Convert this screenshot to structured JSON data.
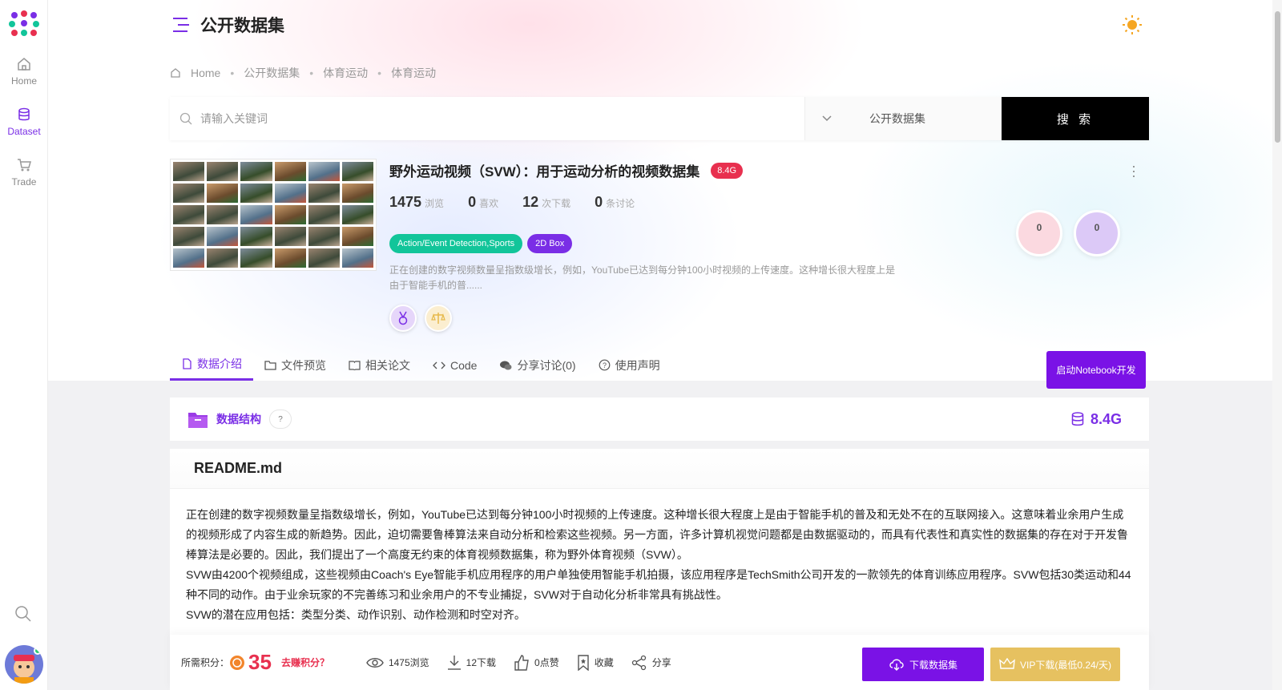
{
  "rail": {
    "items": [
      {
        "label": "Home",
        "icon": "home-icon"
      },
      {
        "label": "Dataset",
        "icon": "database-icon"
      },
      {
        "label": "Trade",
        "icon": "cart-icon"
      }
    ],
    "search_icon": "search-icon"
  },
  "header": {
    "title": "公开数据集",
    "theme_icon": "sun-icon"
  },
  "breadcrumb": [
    "Home",
    "公开数据集",
    "体育运动",
    "体育运动"
  ],
  "search": {
    "placeholder": "请输入关键词",
    "category": "公开数据集",
    "button": "搜 索"
  },
  "dataset": {
    "title": "野外运动视频（SVW）：用于运动分析的视频数据集",
    "size": "8.4G",
    "stats": [
      {
        "value": "1475",
        "unit": "浏览"
      },
      {
        "value": "0",
        "unit": "喜欢"
      },
      {
        "value": "12",
        "unit": "次下载"
      },
      {
        "value": "0",
        "unit": "条讨论"
      }
    ],
    "tags": [
      "Action/Event Detection,Sports",
      "2D Box"
    ],
    "description": "正在创建的数字视频数量呈指数级增长，例如，YouTube已达到每分钟100小时视频的上传速度。这种增长很大程度上是由于智能手机的普......",
    "circles": [
      "0",
      "0"
    ]
  },
  "tabs": [
    {
      "label": "数据介绍",
      "icon": "file-icon"
    },
    {
      "label": "文件预览",
      "icon": "folder-icon"
    },
    {
      "label": "相关论文",
      "icon": "book-icon"
    },
    {
      "label": "Code",
      "icon": "code-icon"
    },
    {
      "label": "分享讨论(0)",
      "icon": "chat-icon"
    },
    {
      "label": "使用声明",
      "icon": "help-icon"
    }
  ],
  "notebook_button": "启动Notebook开发",
  "structure": {
    "label": "数据结构",
    "help": "?",
    "size": "8.4G"
  },
  "readme": {
    "title": "README.md",
    "paragraphs": [
      "正在创建的数字视频数量呈指数级增长，例如，YouTube已达到每分钟100小时视频的上传速度。这种增长很大程度上是由于智能手机的普及和无处不在的互联网接入。这意味着业余用户生成的视频形成了内容生成的新趋势。因此，迫切需要鲁棒算法来自动分析和检索这些视频。另一方面，许多计算机视觉问题都是由数据驱动的，而具有代表性和真实性的数据集的存在对于开发鲁棒算法是必要的。因此，我们提出了一个高度无约束的体育视频数据集，称为野外体育视频（SVW）。",
      "SVW由4200个视频组成，这些视频由Coach's Eye智能手机应用程序的用户单独使用智能手机拍摄，该应用程序是TechSmith公司开发的一款领先的体育训练应用程序。SVW包括30类运动和44种不同的动作。由于业余玩家的不完善练习和业余用户的不专业捕捉，SVW对于自动化分析非常具有挑战性。",
      "SVW的潜在应用包括：类型分类、动作识别、动作检测和时空对齐。"
    ]
  },
  "bottom": {
    "points_label": "所需积分：",
    "points": "35",
    "earn": "去赚积分？",
    "views": "1475浏览",
    "downloads": "12下载",
    "likes": "0点赞",
    "collect": "收藏",
    "share": "分享",
    "download_button": "下载数据集",
    "vip_button": "VIP下载(最低0.24/天)"
  }
}
